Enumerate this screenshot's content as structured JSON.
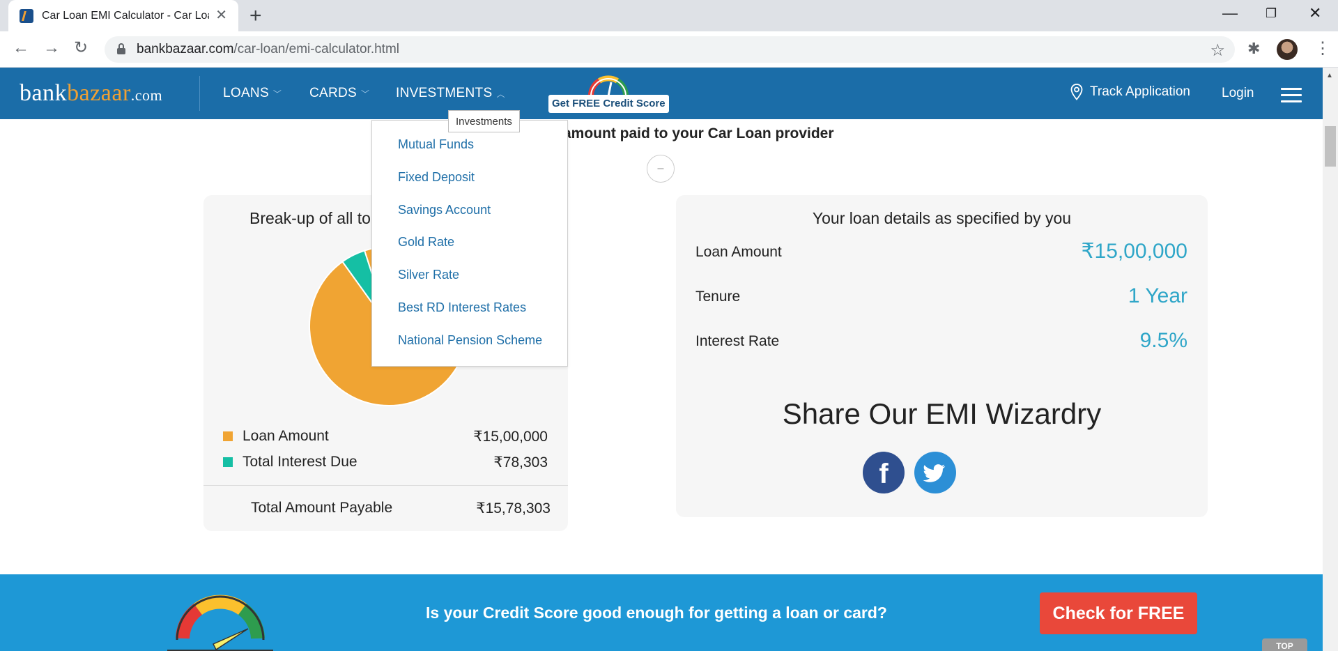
{
  "browser": {
    "tab_title": "Car Loan EMI Calculator - Car Loa",
    "url_domain": "bankbazaar.com",
    "url_path": "/car-loan/emi-calculator.html"
  },
  "site": {
    "logo_bank": "bank",
    "logo_bazaar": "bazaar",
    "logo_com": ".com",
    "nav": [
      "LOANS",
      "CARDS",
      "INVESTMENTS"
    ],
    "credit_badge": "Get FREE Credit Score",
    "track_label": "Track Application",
    "login_label": "Login"
  },
  "dropdown": {
    "tooltip": "Investments",
    "items": [
      "Mutual Funds",
      "Fixed Deposit",
      "Savings Account",
      "Gold Rate",
      "Silver Rate",
      "Best RD Interest Rates",
      "National Pension Scheme"
    ]
  },
  "page": {
    "heading_partial": "amount paid to your Car Loan provider",
    "collapse_symbol": "–"
  },
  "breakup": {
    "title": "Break-up of all to",
    "legend": [
      {
        "label": "Loan Amount",
        "value": "₹15,00,000",
        "color": "#f0a433"
      },
      {
        "label": "Total Interest Due",
        "value": "₹78,303",
        "color": "#15bfa4"
      }
    ],
    "total_label": "Total Amount Payable",
    "total_value": "₹15,78,303"
  },
  "chart_data": {
    "type": "pie",
    "categories": [
      "Loan Amount",
      "Total Interest Due"
    ],
    "values": [
      1500000,
      78303
    ],
    "colors": [
      "#f0a433",
      "#15bfa4"
    ]
  },
  "details": {
    "title": "Your loan details as specified by you",
    "rows": [
      {
        "label": "Loan Amount",
        "value": "₹15,00,000"
      },
      {
        "label": "Tenure",
        "value": "1 Year"
      },
      {
        "label": "Interest Rate",
        "value": "9.5%"
      }
    ],
    "share_title": "Share Our EMI Wizardry",
    "facebook_glyph": "f"
  },
  "banner": {
    "text": "Is your Credit Score good enough for getting a loan or card?",
    "cta": "Check for FREE",
    "top_label": "TOP"
  }
}
